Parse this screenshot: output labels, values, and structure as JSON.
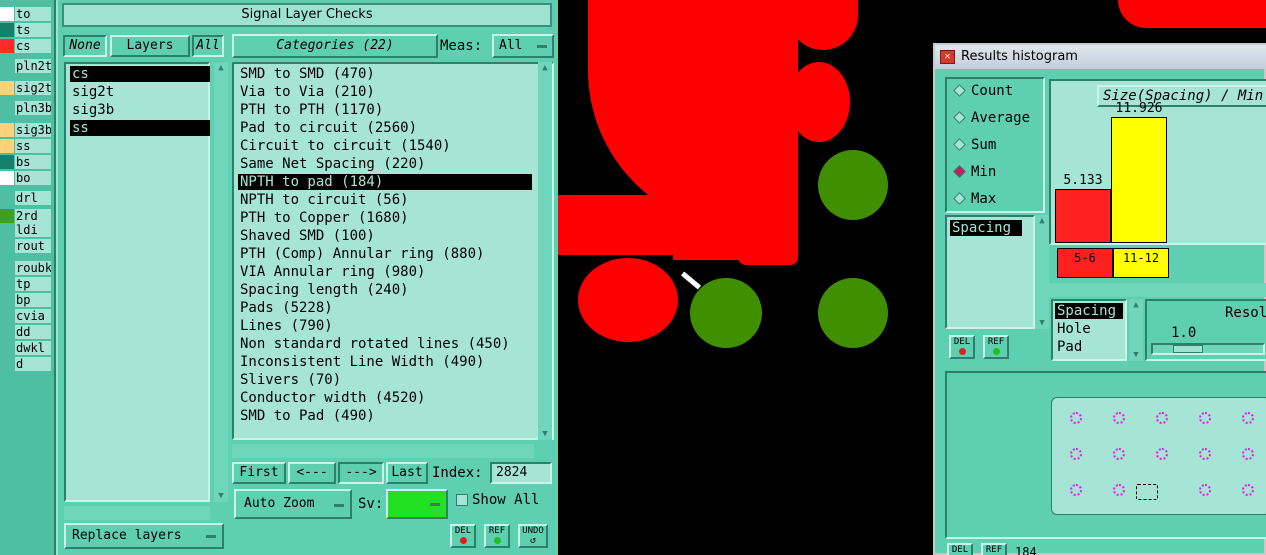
{
  "layers_strip": [
    {
      "name": "to",
      "color": "#ffffff"
    },
    {
      "name": "ts",
      "color": "#16806a"
    },
    {
      "name": "cs",
      "color": "#ff2a2a"
    },
    {
      "name": "pln2t",
      "color": "#4fbfa3"
    },
    {
      "name": "sig2t",
      "color": "#ffd27a"
    },
    {
      "name": "pln3b",
      "color": "#4fbfa3"
    },
    {
      "name": "sig3b",
      "color": "#ffd27a"
    },
    {
      "name": "ss",
      "color": "#ffd27a"
    },
    {
      "name": "bs",
      "color": "#16806a"
    },
    {
      "name": "bo",
      "color": "#ffffff"
    },
    {
      "name": "drl",
      "color": "#4fbfa3"
    },
    {
      "name": "2rd",
      "color": "#3f9f20"
    },
    {
      "name": "ldi",
      "color": "#4fbfa3"
    },
    {
      "name": "rout",
      "color": "#4fbfa3"
    },
    {
      "name": "roubk",
      "color": "#4fbfa3"
    },
    {
      "name": "tp",
      "color": "#4fbfa3"
    },
    {
      "name": "bp",
      "color": "#4fbfa3"
    },
    {
      "name": "cvia",
      "color": "#4fbfa3"
    },
    {
      "name": "dd",
      "color": "#4fbfa3"
    },
    {
      "name": "dwkl",
      "color": "#4fbfa3"
    },
    {
      "name": "d",
      "color": "#4fbfa3"
    }
  ],
  "slc": {
    "title": "Signal Layer Checks",
    "none_btn": "None",
    "layers_btn": "Layers",
    "all_btn": "All",
    "layers": [
      {
        "name": "cs",
        "selected": true
      },
      {
        "name": "sig2t",
        "selected": false
      },
      {
        "name": "sig3b",
        "selected": false
      },
      {
        "name": "ss",
        "selected": true
      }
    ],
    "categories_btn": "Categories (22)",
    "meas_label": "Meas:",
    "meas_value": "All",
    "categories": [
      {
        "label": "SMD to SMD (470)",
        "selected": false
      },
      {
        "label": "Via to Via (210)",
        "selected": false
      },
      {
        "label": "PTH to PTH (1170)",
        "selected": false
      },
      {
        "label": "Pad to circuit (2560)",
        "selected": false
      },
      {
        "label": "Circuit to circuit (1540)",
        "selected": false
      },
      {
        "label": "Same Net Spacing (220)",
        "selected": false
      },
      {
        "label": "NPTH to pad (184)",
        "selected": true
      },
      {
        "label": "NPTH to circuit (56)",
        "selected": false
      },
      {
        "label": "PTH to Copper (1680)",
        "selected": false
      },
      {
        "label": "Shaved SMD (100)",
        "selected": false
      },
      {
        "label": "PTH (Comp) Annular ring (880)",
        "selected": false
      },
      {
        "label": "VIA Annular ring (980)",
        "selected": false
      },
      {
        "label": "Spacing length (240)",
        "selected": false
      },
      {
        "label": "Pads (5228)",
        "selected": false
      },
      {
        "label": "Lines (790)",
        "selected": false
      },
      {
        "label": "Non standard rotated lines (450)",
        "selected": false
      },
      {
        "label": "Inconsistent Line Width (490)",
        "selected": false
      },
      {
        "label": "Slivers (70)",
        "selected": false
      },
      {
        "label": "Conductor width (4520)",
        "selected": false
      },
      {
        "label": "SMD to Pad (490)",
        "selected": false
      }
    ],
    "nav": {
      "first": "First",
      "prev": "<---",
      "next": "--->",
      "last": "Last",
      "index_label": "Index:",
      "index_value": "2824"
    },
    "auto_zoom": "Auto Zoom",
    "sv_label": "Sv:",
    "sv_color": "#22e022",
    "show_all": "Show All",
    "replace_layers": "Replace layers",
    "del": "DEL",
    "ref": "REF",
    "undo": "UNDO"
  },
  "histogram": {
    "window_title": "Results histogram",
    "modes": [
      {
        "label": "Count",
        "on": false
      },
      {
        "label": "Average",
        "on": false
      },
      {
        "label": "Sum",
        "on": false
      },
      {
        "label": "Min",
        "on": true
      },
      {
        "label": "Max",
        "on": false
      }
    ],
    "list_item": "Spacing",
    "chart_title": "Size(Spacing) / Min",
    "measure_list": [
      "Spacing",
      "Hole",
      "Pad"
    ],
    "resol_label": "Resol",
    "resol_value": "1.0",
    "del": "DEL",
    "ref": "REF",
    "bottom_text": "184"
  },
  "chart_data": {
    "type": "bar",
    "title": "Size(Spacing) / Min",
    "categories": [
      "5-6",
      "11-12"
    ],
    "values": [
      5.133,
      11.926
    ],
    "colors": [
      "#ff2020",
      "#ffff00"
    ],
    "ylim": [
      0,
      12.5
    ]
  }
}
